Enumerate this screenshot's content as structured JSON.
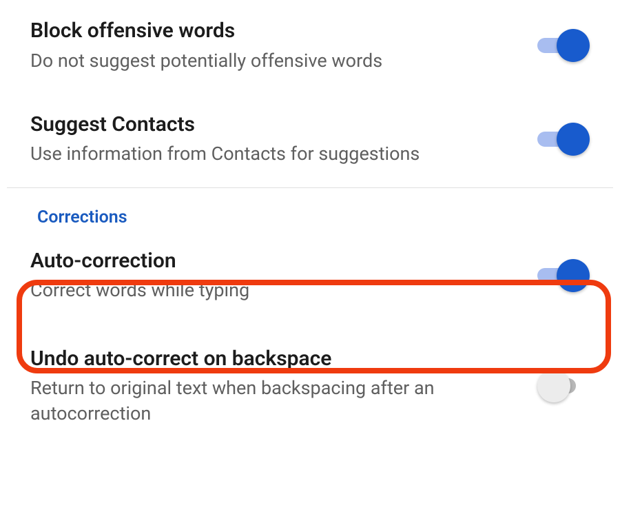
{
  "settings": [
    {
      "title": "Block offensive words",
      "subtitle": "Do not suggest potentially offensive words",
      "on": true
    },
    {
      "title": "Suggest Contacts",
      "subtitle": "Use information from Contacts for suggestions",
      "on": true
    }
  ],
  "section_header": "Corrections",
  "corrections": [
    {
      "title": "Auto-correction",
      "subtitle": "Correct words while typing",
      "on": true
    },
    {
      "title": "Undo auto-correct on backspace",
      "subtitle": "Return to original text when backspacing after an autocorrection",
      "on": false
    }
  ],
  "colors": {
    "accent": "#185bcd",
    "accent_track": "#a8bdf0",
    "off_track": "#b8b8b8",
    "off_thumb": "#ececec",
    "header": "#195abf",
    "highlight": "#ef3b0f"
  }
}
